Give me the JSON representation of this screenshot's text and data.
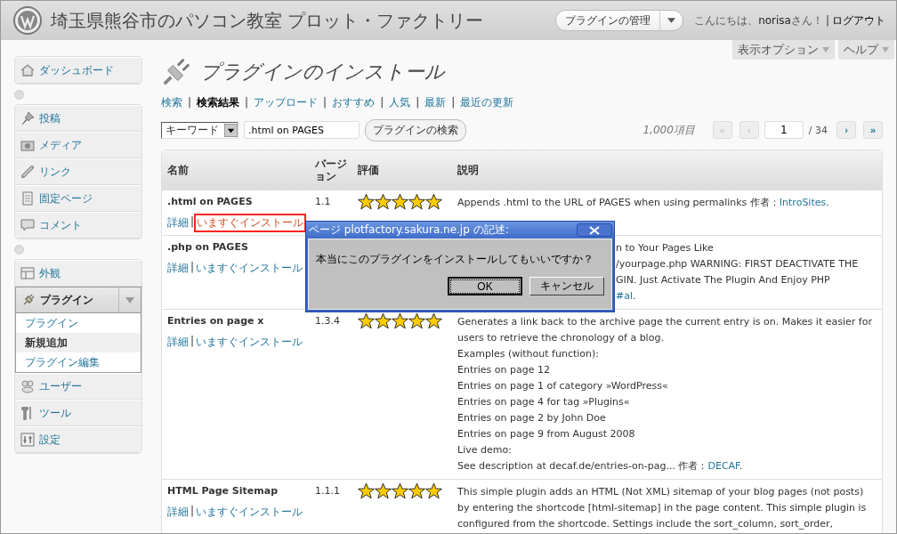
{
  "header": {
    "site_title": "埼玉県熊谷市のパソコン教室 プロット・ファクトリー",
    "favorite_action": "プラグインの管理",
    "greeting_prefix": "こんにちは、",
    "user": "norisa",
    "greeting_suffix": "さん！",
    "separator": "|",
    "logout": "ログアウト"
  },
  "screen_meta": [
    {
      "label": "表示オプション"
    },
    {
      "label": "ヘルプ"
    }
  ],
  "menu": [
    {
      "items": [
        {
          "label": "ダッシュボード",
          "selected": false,
          "expanded": false
        }
      ]
    },
    {
      "items": [
        {
          "label": "投稿",
          "selected": false,
          "expanded": false
        },
        {
          "label": "メディア",
          "selected": false,
          "expanded": false
        },
        {
          "label": "リンク",
          "selected": false,
          "expanded": false
        },
        {
          "label": "固定ページ",
          "selected": false,
          "expanded": false
        },
        {
          "label": "コメント",
          "selected": false,
          "expanded": false
        }
      ]
    },
    {
      "items": [
        {
          "label": "外観",
          "selected": false,
          "expanded": false
        },
        {
          "label": "プラグイン",
          "selected": true,
          "expanded": true,
          "children": [
            {
              "label": "プラグイン",
              "selected": false
            },
            {
              "label": "新規追加",
              "selected": true
            },
            {
              "label": "プラグイン編集",
              "selected": false
            }
          ]
        },
        {
          "label": "ユーザー",
          "selected": false,
          "expanded": false
        },
        {
          "label": "ツール",
          "selected": false,
          "expanded": false
        },
        {
          "label": "設定",
          "selected": false,
          "expanded": false
        }
      ]
    }
  ],
  "page_title": "プラグインのインストール",
  "tab_separator": "|",
  "tabs": [
    {
      "label": "検索",
      "selected": false
    },
    {
      "label": "検索結果",
      "selected": true
    },
    {
      "label": "アップロード",
      "selected": false
    },
    {
      "label": "おすすめ",
      "selected": false
    },
    {
      "label": "人気",
      "selected": false
    },
    {
      "label": "最新",
      "selected": false
    },
    {
      "label": "最近の更新",
      "selected": false
    }
  ],
  "search": {
    "type": "キーワード",
    "value": ".html on PAGES",
    "button": "プラグインの検索"
  },
  "pagination": {
    "count": "1,000項目",
    "page": "1",
    "total": "/ 34",
    "buttons": [
      {
        "label": "«",
        "disabled": true
      },
      {
        "label": "‹",
        "disabled": true
      },
      {
        "label": "›",
        "disabled": false
      },
      {
        "label": "»",
        "disabled": false
      }
    ]
  },
  "table": {
    "columns": [
      "名前",
      "バージョン",
      "評価",
      "説明"
    ],
    "rows": [
      {
        "name": ".html on PAGES",
        "version": "1.1",
        "stars": 5,
        "details": "詳細",
        "separator": "|",
        "install": "いますぐインストール",
        "highlighted": true,
        "covered": false,
        "description": [
          {
            "text": "Appends .html to the URL of PAGES when using permalinks",
            "author_label": "作者：",
            "author": "IntroSites",
            "end": "."
          }
        ]
      },
      {
        "name": ".php on PAGES",
        "details": "詳細",
        "separator": "|",
        "install": "いますぐインストール",
        "highlighted": false,
        "covered": true,
        "description": [
          {
            "text": "n to Your Pages Like"
          },
          {
            "text": "/yourpage.php WARNING: FIRST DEACTIVATE THE"
          },
          {
            "text": "GIN. Just Activate The Plugin And Enjoy PHP"
          },
          {
            "author": "#al",
            "end": "."
          }
        ]
      },
      {
        "name": "Entries on page x",
        "version": "1.3.4",
        "stars": 5,
        "details": "詳細",
        "separator": "|",
        "install": "いますぐインストール",
        "highlighted": false,
        "covered": false,
        "description": [
          {
            "text": "Generates a link back to the archive page the current entry is on. Makes it easier for users to retrieve the chronology of a blog."
          },
          {
            "text": "Examples (without function):"
          },
          {
            "text": "Entries on page 12"
          },
          {
            "text": "Entries on page 1 of category »WordPress«"
          },
          {
            "text": "Entries on page 4 for tag »Plugins«"
          },
          {
            "text": "Entries on page 2 by John Doe"
          },
          {
            "text": "Entries on page 9 from August 2008"
          },
          {
            "text": "Live demo:"
          },
          {
            "text": "See description at decaf.de/entries-on-pag...",
            "author_label": "作者：",
            "author": "DECAF",
            "end": "."
          }
        ]
      },
      {
        "name": "HTML Page Sitemap",
        "version": "1.1.1",
        "stars": 5,
        "details": "詳細",
        "separator": "|",
        "install": "いますぐインストール",
        "highlighted": false,
        "covered": false,
        "description": [
          {
            "text": "This simple plugin adds an HTML (Not XML) sitemap of your blog pages (not posts) by entering the shortcode [html-sitemap] in the page content. This simple plugin is configured from the shortcode. Settings include the sort_column, sort_order,"
          }
        ]
      }
    ]
  },
  "dialog": {
    "title": "ページ plotfactory.sakura.ne.jp の記述:",
    "message": "本当にこのプラグインをインストールしてもいいですか？",
    "buttons": [
      {
        "label": "OK",
        "default": true
      },
      {
        "label": "キャンセル",
        "default": false
      }
    ]
  }
}
